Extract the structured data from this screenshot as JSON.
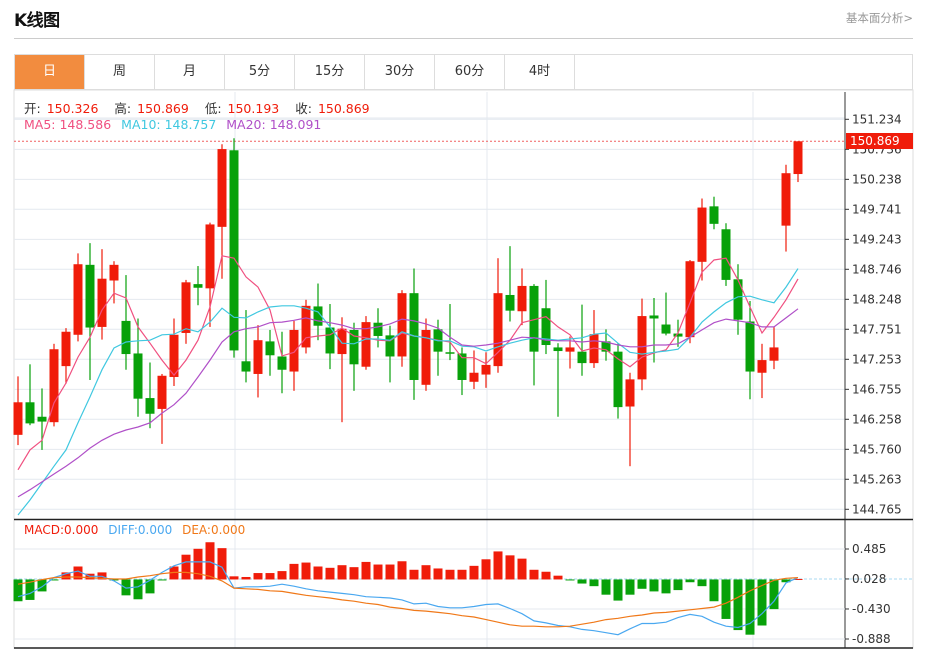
{
  "header": {
    "title": "K线图",
    "more_link": "基本面分析>"
  },
  "tabs": [
    {
      "label": "日",
      "active": true
    },
    {
      "label": "周"
    },
    {
      "label": "月"
    },
    {
      "label": "5分"
    },
    {
      "label": "15分"
    },
    {
      "label": "30分"
    },
    {
      "label": "60分"
    },
    {
      "label": "4时"
    }
  ],
  "ohlc_legend": {
    "open_label": "开:",
    "open": "150.326",
    "high_label": "高:",
    "high": "150.869",
    "low_label": "低:",
    "low": "150.193",
    "close_label": "收:",
    "close": "150.869"
  },
  "ma_legend": {
    "ma5": "MA5: 148.586",
    "ma10": "MA10: 148.757",
    "ma20": "MA20: 148.091"
  },
  "macd_legend": {
    "macd": "MACD:0.000",
    "diff": "DIFF:0.000",
    "dea": "DEA:0.000"
  },
  "last_price": "150.869",
  "colors": {
    "up": "#f01c0a",
    "down": "#08a10a",
    "ma5": "#f05080",
    "ma10": "#40c8e0",
    "ma20": "#b050c8",
    "diff": "#4aa8f0",
    "dea": "#f07818",
    "accent": "#f28c3f"
  },
  "chart_data": [
    {
      "type": "candlestick",
      "y_ticks": [
        "151.234",
        "150.736",
        "150.238",
        "149.741",
        "149.243",
        "148.746",
        "148.248",
        "147.751",
        "147.253",
        "146.755",
        "146.258",
        "145.760",
        "145.263",
        "144.765"
      ],
      "ylim": [
        144.765,
        151.234
      ],
      "grid": true,
      "ohlc": [
        [
          146.0,
          146.97,
          145.83,
          146.54
        ],
        [
          146.54,
          147.17,
          146.16,
          146.19
        ],
        [
          146.3,
          146.77,
          145.75,
          146.22
        ],
        [
          146.21,
          147.51,
          146.14,
          147.42
        ],
        [
          147.14,
          147.77,
          146.85,
          147.71
        ],
        [
          147.66,
          149.01,
          147.55,
          148.83
        ],
        [
          148.82,
          149.18,
          146.91,
          147.78
        ],
        [
          147.79,
          149.08,
          147.58,
          148.59
        ],
        [
          148.56,
          148.88,
          148.18,
          148.82
        ],
        [
          147.89,
          148.65,
          147.08,
          147.34
        ],
        [
          147.35,
          147.93,
          146.3,
          146.6
        ],
        [
          146.61,
          147.2,
          146.11,
          146.35
        ],
        [
          146.43,
          147.01,
          145.85,
          146.98
        ],
        [
          146.96,
          147.93,
          146.81,
          147.66
        ],
        [
          147.69,
          148.57,
          147.51,
          148.53
        ],
        [
          148.5,
          148.8,
          148.15,
          148.44
        ],
        [
          148.43,
          149.52,
          147.79,
          149.49
        ],
        [
          149.45,
          150.82,
          148.59,
          150.74
        ],
        [
          150.72,
          150.92,
          147.28,
          147.4
        ],
        [
          147.22,
          148.07,
          146.87,
          147.05
        ],
        [
          147.01,
          147.82,
          146.62,
          147.57
        ],
        [
          147.55,
          147.74,
          146.98,
          147.32
        ],
        [
          147.3,
          147.71,
          146.69,
          147.08
        ],
        [
          147.05,
          147.89,
          146.73,
          147.74
        ],
        [
          147.45,
          148.24,
          147.35,
          148.14
        ],
        [
          148.13,
          148.51,
          147.57,
          147.81
        ],
        [
          147.78,
          148.17,
          147.09,
          147.35
        ],
        [
          147.34,
          147.95,
          146.21,
          147.76
        ],
        [
          147.74,
          147.86,
          146.73,
          147.17
        ],
        [
          147.13,
          147.97,
          147.08,
          147.87
        ],
        [
          147.86,
          148.1,
          147.45,
          147.64
        ],
        [
          147.65,
          147.81,
          146.87,
          147.3
        ],
        [
          147.3,
          148.4,
          147.13,
          148.35
        ],
        [
          148.35,
          148.76,
          146.58,
          146.91
        ],
        [
          146.83,
          147.93,
          146.73,
          147.74
        ],
        [
          147.75,
          147.91,
          146.98,
          147.38
        ],
        [
          147.37,
          148.17,
          147.24,
          147.36
        ],
        [
          147.35,
          147.45,
          146.66,
          146.91
        ],
        [
          146.88,
          147.4,
          146.76,
          147.03
        ],
        [
          147.0,
          147.37,
          146.78,
          147.16
        ],
        [
          147.14,
          148.93,
          147.03,
          148.35
        ],
        [
          148.32,
          149.13,
          147.88,
          148.06
        ],
        [
          148.05,
          148.76,
          147.82,
          148.47
        ],
        [
          148.47,
          148.5,
          146.82,
          147.38
        ],
        [
          148.1,
          148.57,
          147.34,
          147.49
        ],
        [
          147.45,
          147.52,
          146.3,
          147.39
        ],
        [
          147.38,
          147.63,
          147.1,
          147.45
        ],
        [
          147.38,
          148.16,
          146.98,
          147.19
        ],
        [
          147.19,
          148.07,
          147.11,
          147.67
        ],
        [
          147.55,
          147.75,
          147.23,
          147.38
        ],
        [
          147.38,
          147.52,
          146.27,
          146.46
        ],
        [
          146.47,
          147.03,
          145.48,
          146.92
        ],
        [
          146.92,
          148.26,
          146.74,
          147.97
        ],
        [
          147.98,
          148.27,
          147.2,
          147.93
        ],
        [
          147.83,
          148.36,
          147.65,
          147.68
        ],
        [
          147.68,
          147.91,
          147.46,
          147.63
        ],
        [
          147.62,
          148.9,
          147.52,
          148.88
        ],
        [
          148.87,
          149.92,
          148.56,
          149.77
        ],
        [
          149.79,
          149.95,
          149.41,
          149.5
        ],
        [
          149.41,
          149.51,
          148.47,
          148.57
        ],
        [
          148.58,
          148.83,
          147.66,
          147.91
        ],
        [
          147.88,
          148.22,
          146.59,
          147.05
        ],
        [
          147.03,
          147.51,
          146.61,
          147.24
        ],
        [
          147.23,
          147.79,
          147.09,
          147.45
        ],
        [
          149.47,
          150.48,
          149.04,
          150.34
        ],
        [
          150.326,
          150.869,
          150.193,
          150.869
        ]
      ],
      "series": [
        {
          "name": "MA5",
          "values": [
            145.42,
            145.75,
            145.91,
            146.53,
            146.86,
            147.29,
            147.62,
            148.07,
            148.35,
            148.27,
            147.79,
            147.52,
            147.24,
            146.99,
            147.24,
            147.57,
            148.12,
            148.97,
            148.93,
            148.62,
            148.45,
            148.07,
            147.31,
            147.37,
            147.61,
            147.64,
            147.66,
            147.77,
            147.64,
            147.61,
            147.57,
            147.56,
            147.69,
            147.64,
            147.61,
            147.57,
            147.54,
            147.28,
            147.28,
            147.18,
            147.37,
            147.57,
            147.86,
            147.91,
            147.96,
            147.79,
            147.66,
            147.39,
            147.44,
            147.41,
            147.26,
            147.13,
            147.29,
            147.36,
            147.41,
            147.69,
            148.19,
            148.7,
            148.9,
            148.93,
            148.57,
            148.12,
            147.69,
            147.95,
            148.24,
            148.586
          ]
        },
        {
          "name": "MA10",
          "values": [
            144.67,
            144.92,
            145.2,
            145.48,
            145.75,
            146.2,
            146.63,
            147.08,
            147.44,
            147.54,
            147.56,
            147.57,
            147.66,
            147.67,
            147.76,
            147.71,
            147.87,
            148.1,
            147.95,
            147.94,
            148.04,
            148.12,
            148.14,
            148.14,
            148.1,
            148.04,
            147.79,
            147.52,
            147.51,
            147.59,
            147.59,
            147.57,
            147.71,
            147.64,
            147.61,
            147.56,
            147.56,
            147.47,
            147.46,
            147.39,
            147.46,
            147.52,
            147.57,
            147.61,
            147.59,
            147.57,
            147.59,
            147.61,
            147.67,
            147.69,
            147.52,
            147.37,
            147.34,
            147.37,
            147.39,
            147.42,
            147.62,
            147.87,
            148.04,
            148.19,
            148.29,
            148.3,
            148.24,
            148.19,
            148.45,
            148.757
          ]
        },
        {
          "name": "MA20",
          "values": [
            144.97,
            145.09,
            145.22,
            145.35,
            145.48,
            145.62,
            145.78,
            145.91,
            146.01,
            146.08,
            146.13,
            146.2,
            146.36,
            146.5,
            146.69,
            146.96,
            147.24,
            147.54,
            147.71,
            147.76,
            147.79,
            147.86,
            147.87,
            147.9,
            147.94,
            147.89,
            147.86,
            147.82,
            147.76,
            147.76,
            147.79,
            147.84,
            147.92,
            147.89,
            147.84,
            147.77,
            147.62,
            147.49,
            147.47,
            147.49,
            147.52,
            147.57,
            147.62,
            147.61,
            147.57,
            147.56,
            147.56,
            147.54,
            147.56,
            147.54,
            147.49,
            147.46,
            147.46,
            147.49,
            147.49,
            147.51,
            147.62,
            147.74,
            147.86,
            147.92,
            147.89,
            147.86,
            147.79,
            147.79,
            147.94,
            148.091
          ]
        }
      ]
    },
    {
      "type": "bar+line",
      "y_ticks": [
        "0.485",
        "0.028",
        "-0.430",
        "-0.888"
      ],
      "ylim": [
        -0.888,
        0.485
      ],
      "series": [
        {
          "name": "MACD",
          "values": [
            -0.34,
            -0.32,
            -0.19,
            -0.01,
            0.1,
            0.19,
            0.08,
            0.1,
            -0.02,
            -0.25,
            -0.31,
            -0.22,
            -0.01,
            0.19,
            0.37,
            0.46,
            0.56,
            0.47,
            0.04,
            0.03,
            0.09,
            0.09,
            0.12,
            0.23,
            0.25,
            0.19,
            0.17,
            0.21,
            0.18,
            0.26,
            0.22,
            0.22,
            0.27,
            0.14,
            0.21,
            0.16,
            0.14,
            0.14,
            0.2,
            0.3,
            0.42,
            0.36,
            0.31,
            0.14,
            0.11,
            0.05,
            -0.02,
            -0.07,
            -0.11,
            -0.24,
            -0.33,
            -0.24,
            -0.15,
            -0.19,
            -0.22,
            -0.17,
            -0.05,
            -0.11,
            -0.34,
            -0.61,
            -0.78,
            -0.85,
            -0.71,
            -0.46,
            -0.05,
            0.0
          ]
        },
        {
          "name": "DIFF",
          "values": [
            -0.27,
            -0.22,
            -0.12,
            0.02,
            0.08,
            0.12,
            0.04,
            0.04,
            -0.03,
            -0.14,
            -0.12,
            -0.02,
            0.1,
            0.2,
            0.26,
            0.26,
            0.26,
            0.18,
            -0.14,
            -0.12,
            -0.12,
            -0.11,
            -0.08,
            -0.11,
            -0.15,
            -0.18,
            -0.2,
            -0.22,
            -0.24,
            -0.27,
            -0.28,
            -0.29,
            -0.32,
            -0.38,
            -0.37,
            -0.42,
            -0.44,
            -0.44,
            -0.42,
            -0.39,
            -0.38,
            -0.45,
            -0.53,
            -0.64,
            -0.67,
            -0.71,
            -0.73,
            -0.77,
            -0.79,
            -0.82,
            -0.85,
            -0.76,
            -0.68,
            -0.68,
            -0.66,
            -0.59,
            -0.54,
            -0.57,
            -0.66,
            -0.72,
            -0.74,
            -0.68,
            -0.53,
            -0.34,
            -0.06,
            0.02
          ]
        },
        {
          "name": "DEA",
          "values": [
            -0.08,
            -0.05,
            -0.01,
            0.02,
            0.03,
            0.03,
            0.02,
            0.01,
            0.0,
            0.0,
            0.03,
            0.05,
            0.08,
            0.1,
            0.1,
            0.08,
            0.04,
            -0.03,
            -0.14,
            -0.15,
            -0.16,
            -0.18,
            -0.19,
            -0.22,
            -0.25,
            -0.27,
            -0.29,
            -0.32,
            -0.34,
            -0.37,
            -0.39,
            -0.43,
            -0.45,
            -0.48,
            -0.49,
            -0.51,
            -0.53,
            -0.56,
            -0.58,
            -0.62,
            -0.66,
            -0.7,
            -0.72,
            -0.72,
            -0.73,
            -0.73,
            -0.72,
            -0.69,
            -0.66,
            -0.62,
            -0.6,
            -0.57,
            -0.55,
            -0.52,
            -0.51,
            -0.49,
            -0.47,
            -0.45,
            -0.43,
            -0.37,
            -0.28,
            -0.18,
            -0.1,
            -0.02,
            0.01,
            0.02
          ]
        }
      ]
    }
  ]
}
